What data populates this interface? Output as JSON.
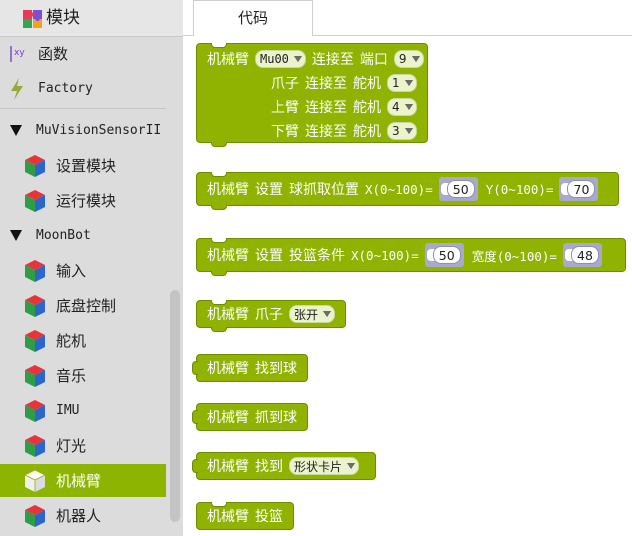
{
  "sidebar": {
    "header": "模块",
    "items": [
      {
        "label": "函数",
        "icon": "function-xy-icon"
      },
      {
        "label": "Factory",
        "icon": "lightning-icon"
      },
      {
        "label": "MuVisionSensorII",
        "icon": "collapse-triangle-icon"
      },
      {
        "label": "设置模块",
        "icon": "cube-icon"
      },
      {
        "label": "运行模块",
        "icon": "cube-icon"
      },
      {
        "label": "MoonBot",
        "icon": "collapse-triangle-icon"
      },
      {
        "label": "输入",
        "icon": "cube-icon"
      },
      {
        "label": "底盘控制",
        "icon": "cube-icon"
      },
      {
        "label": "舵机",
        "icon": "cube-icon"
      },
      {
        "label": "音乐",
        "icon": "cube-icon"
      },
      {
        "label": "IMU",
        "icon": "cube-icon"
      },
      {
        "label": "灯光",
        "icon": "cube-icon"
      },
      {
        "label": "机械臂",
        "icon": "cube-white-icon",
        "active": true
      },
      {
        "label": "机器人",
        "icon": "cube-icon"
      }
    ]
  },
  "tabs": {
    "code_label": "代码"
  },
  "blocks": {
    "b1": {
      "r1": {
        "t1": "机械臂",
        "dd1": "Mu00",
        "t2": "连接至",
        "t3": "端口",
        "dd2": "9"
      },
      "r2": {
        "t1": "爪子",
        "t2": "连接至",
        "t3": "舵机",
        "dd1": "1"
      },
      "r3": {
        "t1": "上臂",
        "t2": "连接至",
        "t3": "舵机",
        "dd1": "4"
      },
      "r4": {
        "t1": "下臂",
        "t2": "连接至",
        "t3": "舵机",
        "dd1": "3"
      }
    },
    "b2": {
      "t1": "机械臂",
      "t2": "设置",
      "t3": "球抓取位置",
      "t4": "X(0~100)=",
      "v1": "50",
      "t5": "Y(0~100)=",
      "v2": "70"
    },
    "b3": {
      "t1": "机械臂",
      "t2": "设置",
      "t3": "投篮条件",
      "t4": "X(0~100)=",
      "v1": "50",
      "t5": "宽度(0~100)=",
      "v2": "48"
    },
    "b4": {
      "t1": "机械臂",
      "t2": "爪子",
      "dd1": "张开"
    },
    "b5": {
      "t1": "机械臂",
      "t2": "找到球"
    },
    "b6": {
      "t1": "机械臂",
      "t2": "抓到球"
    },
    "b7": {
      "t1": "机械臂",
      "t2": "找到",
      "dd1": "形状卡片"
    },
    "b8": {
      "t1": "机械臂",
      "t2": "投篮"
    }
  },
  "colors": {
    "block_green": "#8fb300",
    "active_item": "#8cb400",
    "sidebar_bg": "#dcdcdc"
  }
}
